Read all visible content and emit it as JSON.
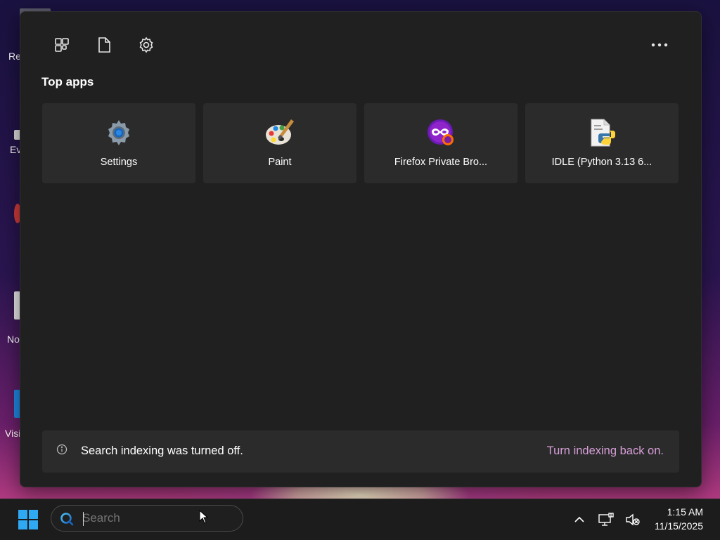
{
  "desktop": {
    "icons": [
      {
        "label": "Re"
      },
      {
        "label": "Ev"
      },
      {
        "label": "No"
      },
      {
        "label": "Visi"
      }
    ]
  },
  "start_menu": {
    "section_title": "Top apps",
    "apps": [
      {
        "name": "Settings",
        "icon": "settings-gear-icon"
      },
      {
        "name": "Paint",
        "icon": "paint-palette-icon"
      },
      {
        "name": "Firefox Private Bro...",
        "icon": "firefox-private-icon"
      },
      {
        "name": "IDLE (Python 3.13 6...",
        "icon": "python-idle-icon"
      }
    ],
    "notice": {
      "message": "Search indexing was turned off.",
      "link": "Turn indexing back on."
    }
  },
  "taskbar": {
    "search": {
      "placeholder": "Search"
    },
    "clock": {
      "time": "1:15 AM",
      "date": "11/15/2025"
    }
  },
  "colors": {
    "panel_bg": "#202020",
    "tile_bg": "#2b2b2b",
    "link": "#d79fd8"
  }
}
